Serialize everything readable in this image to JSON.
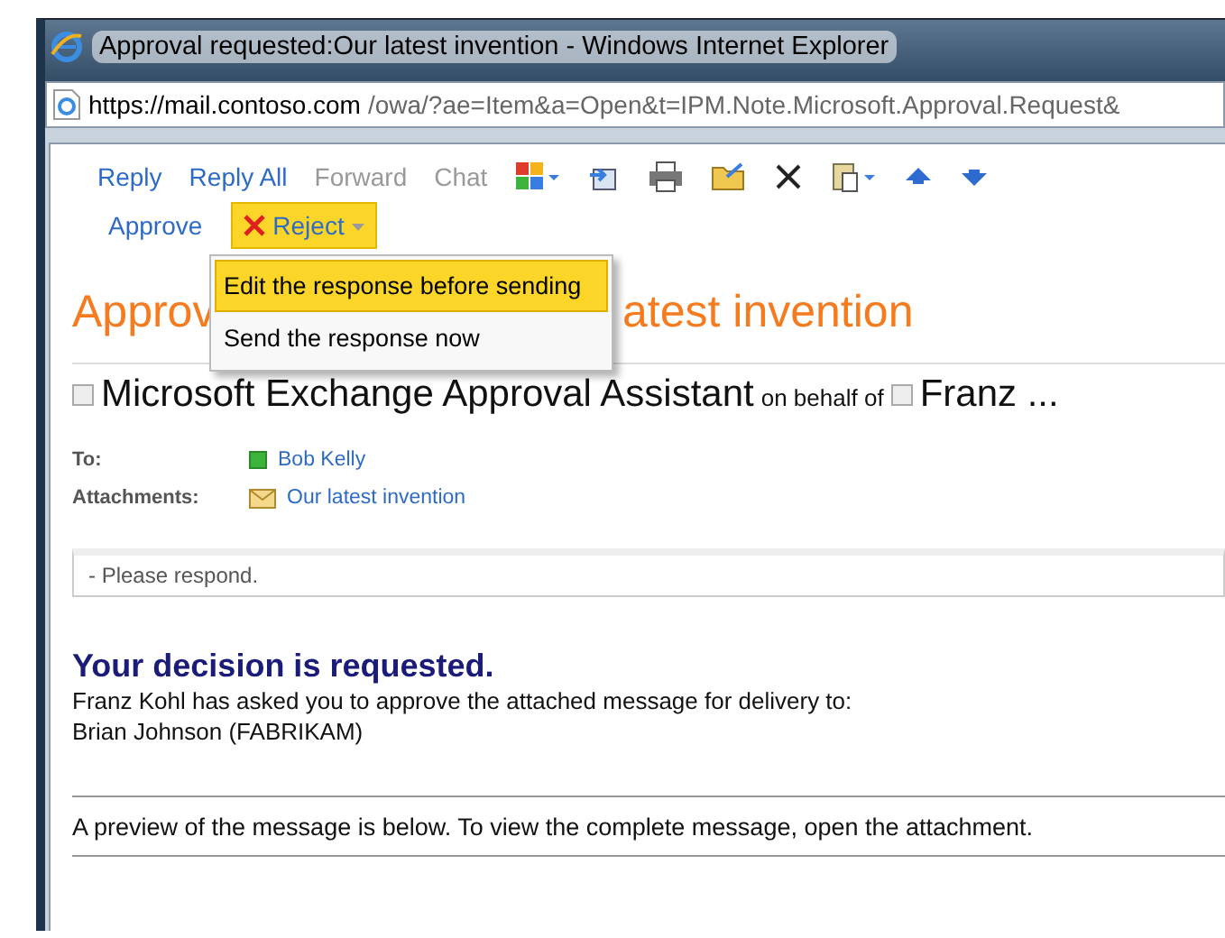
{
  "window": {
    "title": "Approval requested:Our latest invention - Windows Internet Explorer"
  },
  "address_bar": {
    "host": "https://mail.contoso.com",
    "path": "/owa/?ae=Item&a=Open&t=IPM.Note.Microsoft.Approval.Request&"
  },
  "toolbar": {
    "items": [
      {
        "kind": "link",
        "label": "Reply",
        "disabled": false
      },
      {
        "kind": "link",
        "label": "Reply All",
        "disabled": false
      },
      {
        "kind": "link",
        "label": "Forward",
        "disabled": true
      },
      {
        "kind": "link",
        "label": "Chat",
        "disabled": true
      },
      {
        "kind": "categories"
      },
      {
        "kind": "move"
      },
      {
        "kind": "print"
      },
      {
        "kind": "folder"
      },
      {
        "kind": "delete"
      },
      {
        "kind": "paste"
      },
      {
        "kind": "up"
      },
      {
        "kind": "down"
      }
    ],
    "row2": [
      {
        "label": "Approve",
        "selected": false,
        "menu": false
      },
      {
        "label": "Reject",
        "selected": true,
        "menu": true
      }
    ]
  },
  "reject_menu": [
    {
      "label": "Edit the response before sending",
      "selected": true
    },
    {
      "label": "Send the response now",
      "selected": false
    }
  ],
  "message": {
    "subject_visible_start": "Approv",
    "subject_visible_end": "atest invention",
    "sender": "Microsoft Exchange Approval Assistant",
    "on_behalf": "on behalf of",
    "delegate": "Franz ...",
    "to_label": "To:",
    "to": "Bob Kelly",
    "attachments_label": "Attachments:",
    "attachment": "Our latest invention",
    "note": "- Please respond.",
    "decision_heading": "Your decision is requested.",
    "body_lines": [
      "Franz Kohl has asked you to approve the attached message for delivery to:",
      "Brian Johnson (FABRIKAM)"
    ],
    "preview_note": "A preview of the message is below. To view the complete message, open the attachment."
  }
}
